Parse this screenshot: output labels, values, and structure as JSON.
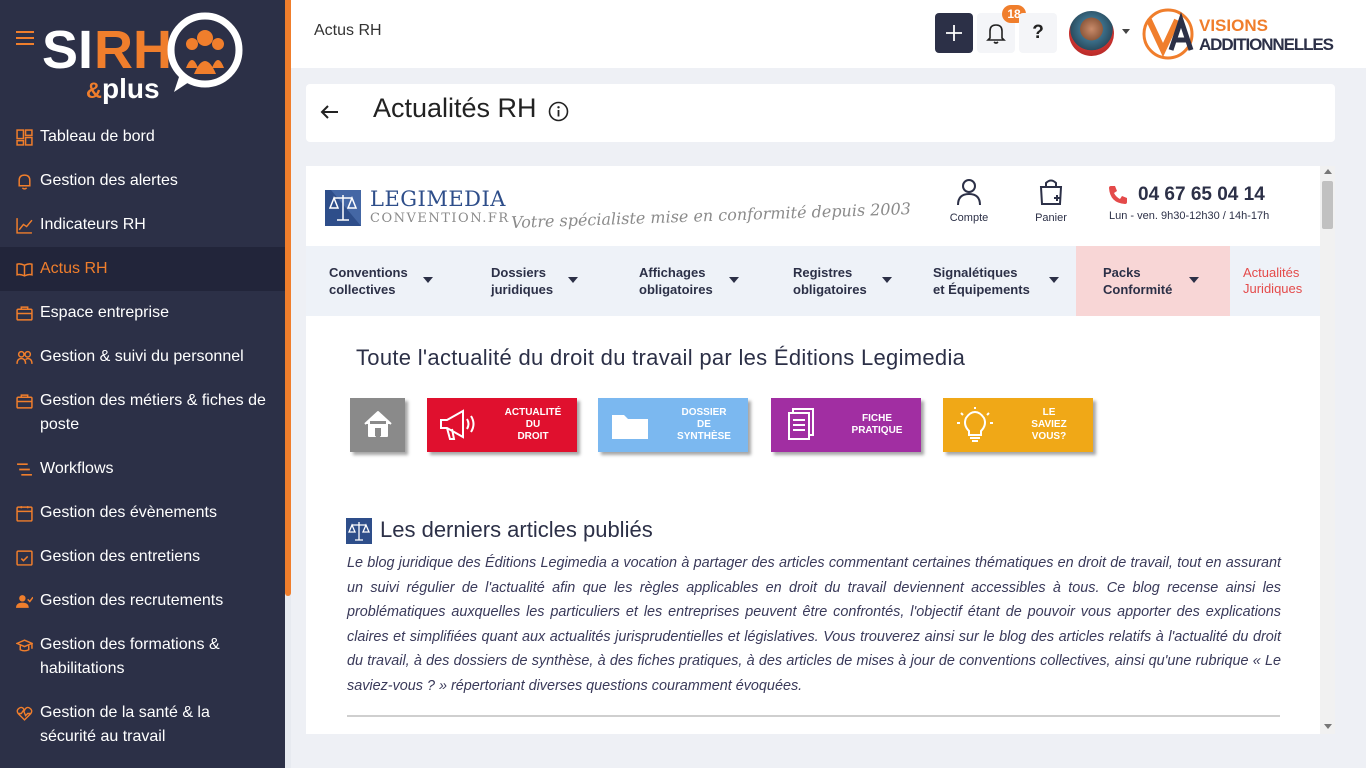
{
  "sidebar": {
    "logo_text": "SIRH",
    "logo_sub": "&plus",
    "items": [
      {
        "label": "Tableau de bord",
        "icon": "dashboard-icon"
      },
      {
        "label": "Gestion des alertes",
        "icon": "bell-icon"
      },
      {
        "label": "Indicateurs RH",
        "icon": "chart-line-icon"
      },
      {
        "label": "Actus RH",
        "icon": "book-icon",
        "active": true
      },
      {
        "label": "Espace entreprise",
        "icon": "briefcase-icon"
      },
      {
        "label": "Gestion & suivi du personnel",
        "icon": "users-icon"
      },
      {
        "label": "Gestion des métiers & fiches de poste",
        "icon": "briefcase-icon"
      },
      {
        "label": "Workflows",
        "icon": "workflow-icon"
      },
      {
        "label": "Gestion des évènements",
        "icon": "calendar-icon"
      },
      {
        "label": "Gestion des entretiens",
        "icon": "calendar-check-icon"
      },
      {
        "label": "Gestion des recrutements",
        "icon": "user-check-icon"
      },
      {
        "label": "Gestion des formations & habilitations",
        "icon": "graduation-cap-icon"
      },
      {
        "label": "Gestion de la santé & la sécurité au travail",
        "icon": "heart-pulse-icon"
      }
    ]
  },
  "header": {
    "breadcrumb": "Actus RH",
    "notification_count": "18",
    "help_label": "?",
    "brand_top": "VISIONS",
    "brand_bottom": "ADDITIONNELLES"
  },
  "title_card": {
    "title": "Actualités RH"
  },
  "legimedia": {
    "brand": "LEGIMEDIA",
    "brand_sub": "CONVENTION.FR",
    "tagline": "Votre spécialiste mise en conformité depuis 2003",
    "account_label": "Compte",
    "cart_label": "Panier",
    "phone": "04 67 65 04 14",
    "hours": "Lun - ven. 9h30-12h30 / 14h-17h",
    "menu": [
      {
        "line1": "Conventions",
        "line2": "collectives"
      },
      {
        "line1": "Dossiers",
        "line2": "juridiques"
      },
      {
        "line1": "Affichages",
        "line2": "obligatoires"
      },
      {
        "line1": "Registres",
        "line2": "obligatoires"
      },
      {
        "line1": "Signalétiques",
        "line2": "et Équipements"
      },
      {
        "line1": "Packs",
        "line2": "Conformité"
      },
      {
        "line1": "Actualités",
        "line2": "Juridiques"
      }
    ],
    "headline": "Toute l'actualité du droit du travail par les Éditions Legimedia",
    "tiles": [
      {
        "l1": "ACTUALITÉ",
        "l2": "DU",
        "l3": "DROIT"
      },
      {
        "l1": "DOSSIER",
        "l2": "DE",
        "l3": "SYNTHÈSE"
      },
      {
        "l1": "FICHE",
        "l2": "PRATIQUE",
        "l3": ""
      },
      {
        "l1": "LE",
        "l2": "SAVIEZ",
        "l3": "VOUS?"
      }
    ],
    "section_title": "Les derniers articles publiés",
    "paragraph": "Le blog juridique des Éditions Legimedia a vocation à partager des articles commentant certaines thématiques en droit de travail, tout en assurant un suivi régulier de l'actualité afin que les règles applicables en droit du travail deviennent accessibles à tous. Ce blog recense ainsi les problématiques auxquelles les particuliers et les entreprises peuvent être confrontés, l'objectif étant de pouvoir vous apporter des explications claires et simplifiées quant aux actualités jurisprudentielles et législatives. Vous trouverez ainsi sur le blog des articles relatifs à l'actualité du droit du travail, à des dossiers de synthèse, à des fiches pratiques, à des articles de mises à jour de conventions collectives, ainsi qu'une rubrique « Le saviez-vous ? » répertoriant diverses questions couramment évoquées."
  },
  "colors": {
    "sidebar_bg": "#2c3047",
    "accent": "#f07e2c",
    "actu_red": "#e0102e",
    "dossier_blue": "#7bb8f0",
    "fiche_purple": "#a12ea2",
    "savez_yellow": "#f0a817"
  }
}
